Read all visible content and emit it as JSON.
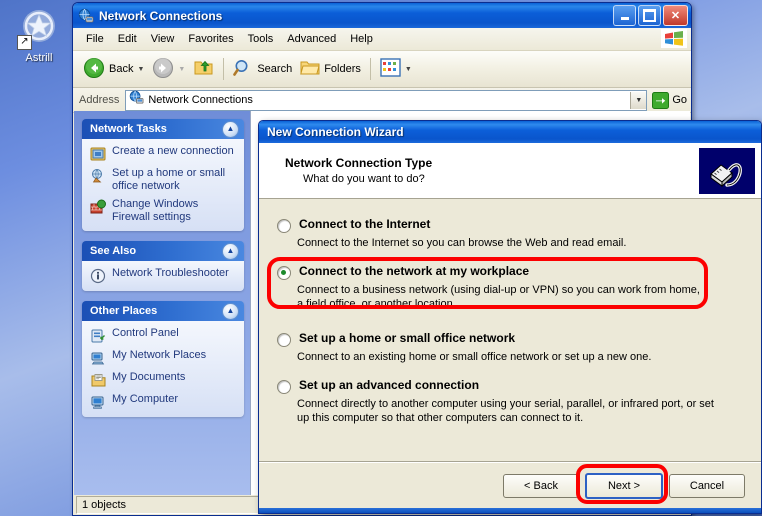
{
  "desktop": {
    "icon": {
      "name": "astrill-shortcut",
      "label": "Astrill",
      "shortcut_glyph": "↗"
    },
    "background_color": "#6d8ee0"
  },
  "explorer": {
    "title": "Network Connections",
    "title_icon": "network-globe-icon",
    "window_buttons": {
      "minimize": "minimize-icon",
      "maximize": "maximize-icon",
      "close": "✕"
    },
    "menu": [
      "File",
      "Edit",
      "View",
      "Favorites",
      "Tools",
      "Advanced",
      "Help"
    ],
    "toolbar": {
      "back_label": "Back",
      "back_icon": "back-arrow-icon",
      "forward_icon": "forward-arrow-icon",
      "up_icon": "up-folder-icon",
      "search_label": "Search",
      "search_icon": "magnifier-icon",
      "folders_label": "Folders",
      "folders_icon": "folder-icon",
      "views_icon": "views-grid-icon",
      "dropdown_glyph": "▼"
    },
    "address": {
      "label": "Address",
      "value": "Network Connections",
      "icon": "network-globe-icon",
      "dropdown_glyph": "▼",
      "go_label": "Go",
      "go_icon": "go-arrow-icon"
    },
    "status": {
      "text": "1 objects"
    },
    "sidebar": {
      "panels": [
        {
          "title": "Network Tasks",
          "collapse_glyph": "▲",
          "items": [
            {
              "label": "Create a new connection",
              "icon": "new-connection-icon"
            },
            {
              "label": "Set up a home or small office network",
              "icon": "home-network-icon"
            },
            {
              "label": "Change Windows Firewall settings",
              "icon": "firewall-icon"
            }
          ]
        },
        {
          "title": "See Also",
          "collapse_glyph": "▲",
          "items": [
            {
              "label": "Network Troubleshooter",
              "icon": "info-icon"
            }
          ]
        },
        {
          "title": "Other Places",
          "collapse_glyph": "▲",
          "items": [
            {
              "label": "Control Panel",
              "icon": "control-panel-icon"
            },
            {
              "label": "My Network Places",
              "icon": "my-network-places-icon"
            },
            {
              "label": "My Documents",
              "icon": "my-documents-icon"
            },
            {
              "label": "My Computer",
              "icon": "my-computer-icon"
            }
          ]
        }
      ]
    }
  },
  "wizard": {
    "title": "New Connection Wizard",
    "heading": "Network Connection Type",
    "subheading": "What do you want to do?",
    "header_icon": "rj45-connector-icon",
    "options": [
      {
        "label": "Connect to the Internet",
        "description": "Connect to the Internet so you can browse the Web and read email.",
        "selected": false
      },
      {
        "label": "Connect to the network at my workplace",
        "description": "Connect to a business network (using dial-up or VPN) so you can work from home, a field office, or another location.",
        "selected": true
      },
      {
        "label": "Set up a home or small office network",
        "description": "Connect to an existing home or small office network or set up a new one.",
        "selected": false
      },
      {
        "label": "Set up an advanced connection",
        "description": "Connect directly to another computer using your serial, parallel, or infrared port, or set up this computer so that other computers can connect to it.",
        "selected": false
      }
    ],
    "buttons": {
      "back": "< Back",
      "next": "Next >",
      "cancel": "Cancel"
    }
  },
  "annotations": {
    "highlight_color": "#fc0000",
    "targets": [
      "workplace-option",
      "next-button"
    ]
  }
}
